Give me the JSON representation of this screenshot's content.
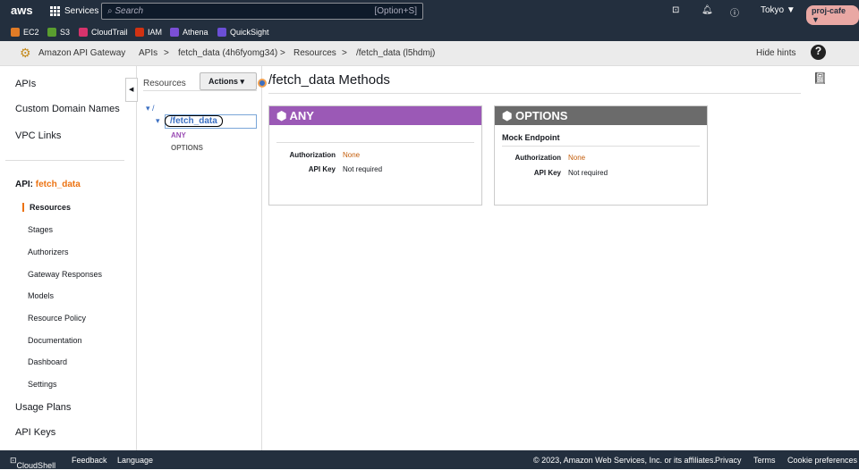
{
  "top": {
    "logo": "aws",
    "services": "Services",
    "search_placeholder": "Search",
    "search_shortcut": "[Option+S]",
    "region": "Tokyo ▼",
    "account": "proj-cafe ▼"
  },
  "favorites": [
    {
      "label": "EC2",
      "color": "#e07b26"
    },
    {
      "label": "S3",
      "color": "#5a9e2f"
    },
    {
      "label": "CloudTrail",
      "color": "#d6336c"
    },
    {
      "label": "IAM",
      "color": "#d13212"
    },
    {
      "label": "Athena",
      "color": "#7b4fd6"
    },
    {
      "label": "QuickSight",
      "color": "#6b4fd6"
    }
  ],
  "breadcrumb": {
    "service": "Amazon API Gateway",
    "items": [
      "APIs",
      ">",
      "fetch_data (4h6fyomg34)",
      ">",
      "Resources",
      ">",
      "/fetch_data (l5hdmj)"
    ],
    "hide_hints": "Hide hints"
  },
  "sidebar": {
    "apis": "APIs",
    "custom_domain": "Custom Domain Names",
    "vpc": "VPC Links",
    "api_label": "API:",
    "api_name": "fetch_data",
    "items": [
      "Resources",
      "Stages",
      "Authorizers",
      "Gateway Responses",
      "Models",
      "Resource Policy",
      "Documentation",
      "Dashboard",
      "Settings"
    ],
    "usage": "Usage Plans",
    "keys": "API Keys"
  },
  "resources": {
    "title": "Resources",
    "actions": "Actions ▾",
    "root": "/",
    "child": "/fetch_data",
    "methods": [
      "ANY",
      "OPTIONS"
    ]
  },
  "main": {
    "title": "/fetch_data Methods",
    "any": {
      "name": "ANY",
      "auth_label": "Authorization",
      "auth": "None",
      "key_label": "API Key",
      "key": "Not required"
    },
    "options": {
      "name": "OPTIONS",
      "sub": "Mock Endpoint",
      "auth_label": "Authorization",
      "auth": "None",
      "key_label": "API Key",
      "key": "Not required"
    }
  },
  "footer": {
    "cloudshell": "CloudShell",
    "feedback": "Feedback",
    "language": "Language",
    "copyright": "© 2023, Amazon Web Services, Inc. or its affiliates.",
    "privacy": "Privacy",
    "terms": "Terms",
    "cookies": "Cookie preferences"
  }
}
